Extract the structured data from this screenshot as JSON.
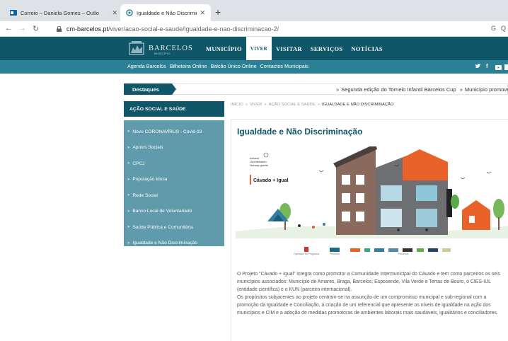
{
  "browser": {
    "tabs": [
      {
        "label": "Correio – Daniela Gomes – Outlo",
        "active": false
      },
      {
        "label": "Igualdade e Não Discriminação |",
        "active": true
      }
    ],
    "new_tab": "+",
    "nav": {
      "back": "←",
      "forward": "→",
      "reload": "↻"
    },
    "url_domain": "cm-barcelos.pt",
    "url_path": "/viver/acao-social-e-saude/igualdade-e-nao-discriminacao-2/",
    "ext": [
      "G",
      "Q"
    ]
  },
  "header": {
    "logo_name": "BARCELOS",
    "logo_sub": "MUNICÍPIO",
    "nav": [
      {
        "label": "MUNICÍPIO",
        "active": false
      },
      {
        "label": "VIVER",
        "active": true
      },
      {
        "label": "VISITAR",
        "active": false
      },
      {
        "label": "SERVIÇOS",
        "active": false
      },
      {
        "label": "NOTÍCIAS",
        "active": false
      }
    ],
    "sublinks": [
      "Agenda Barcelos",
      "Bilheteira Online",
      "Balcão Único Online",
      "Contactos Municipais"
    ],
    "social": [
      "twitter-icon",
      "facebook-icon",
      "youtube-icon"
    ]
  },
  "highlights": {
    "label": "Destaques",
    "items": [
      "Segunda edição do Torneio Infantil Barcelos Cup",
      "Município promove"
    ]
  },
  "sidebar": {
    "title": "AÇÃO SOCIAL E SAÚDE",
    "items": [
      {
        "label": "Novo CORONAVÍRUS - Covid-19"
      },
      {
        "label": "Apoios Sociais"
      },
      {
        "label": "CPCJ"
      },
      {
        "label": "População Idosa"
      },
      {
        "label": "Rede Social"
      },
      {
        "label": "Banco Local de Voluntariado"
      },
      {
        "label": "Saúde Pública e Comunitária"
      },
      {
        "label": "Igualdade e Não Discriminação"
      }
    ]
  },
  "breadcrumb": [
    "INÍCIO",
    "VIVER",
    "AÇÃO SOCIAL E SAÚDE",
    "IGUALDADE E NÃO DISCRIMINAÇÃO"
  ],
  "page": {
    "title": "Igualdade e Não Discriminação",
    "illustration": {
      "funders": "Iceland Liechtenstein Norway grants",
      "project_name": "Cávado + Igual"
    },
    "sponsor_labels": [
      "Operador do Programa",
      "Promotor",
      "Parceiros"
    ],
    "paragraphs": [
      "O Projeto \"Cávado + Igual\" integra como promotor a Comunidade Intermunicipal do Cávado e tem como parceiros os seis municípios associados: Município de Amares, Braga, Barcelos, Esposende, Vila Verde e Terras de Bouro, o CIES-IUL (entidade científica) e o KUN (parceiro internacional).",
      "Os propósitos subjacentes ao projeto centram-se na assunção de um compromisso municipal e sub-regional com a promoção da Igualdade e Conciliação, a criação de um referencial que apresente os níveis de igualdade na ação dos municípios e CIM e a adoção de medidas promotoras de ambientes laborais mais saudáveis, igualitários e conciliadores."
    ]
  },
  "colors": {
    "header": "#0f5669",
    "subnav": "#2b8096",
    "sidebar": "#5f9bab",
    "accent_orange": "#e8622a"
  }
}
